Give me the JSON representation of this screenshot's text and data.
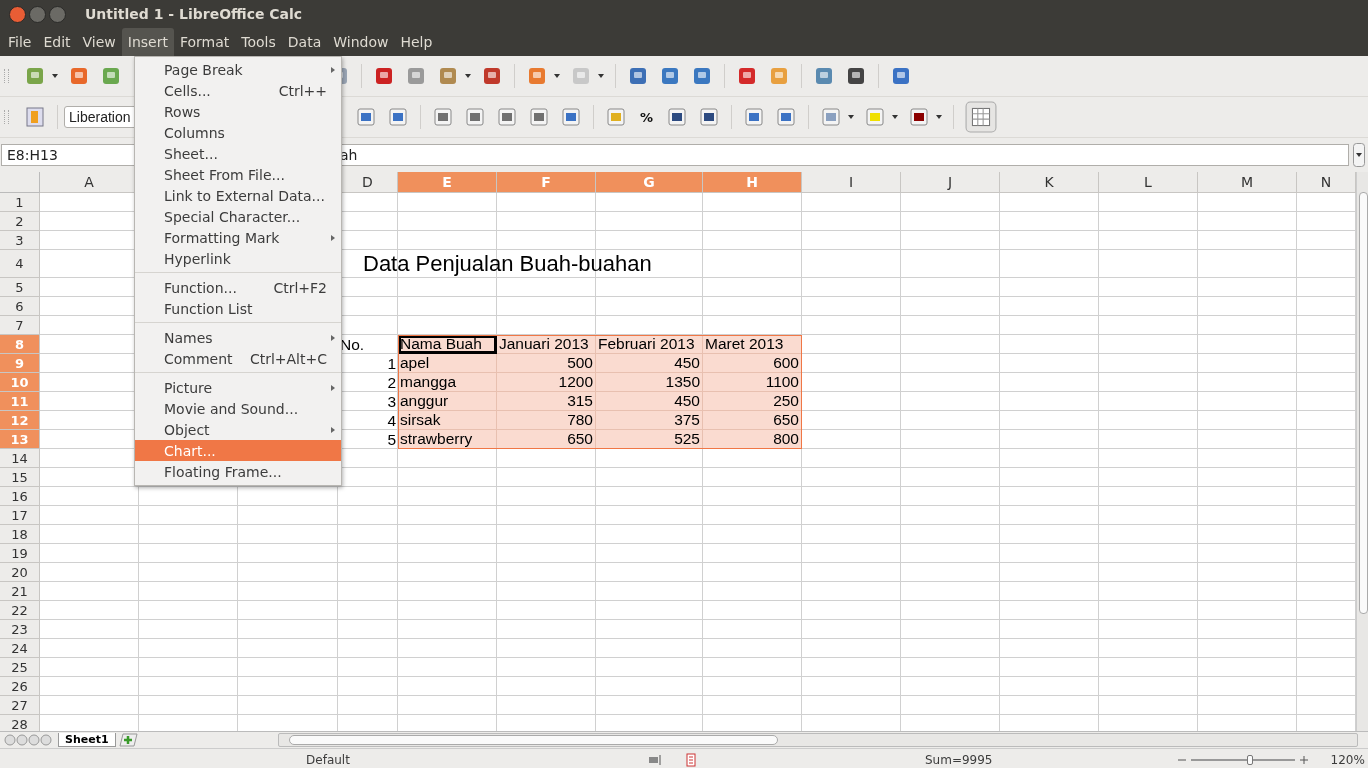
{
  "window": {
    "title": "Untitled 1 - LibreOffice Calc"
  },
  "menu_bar": [
    {
      "label": "File",
      "selected": false
    },
    {
      "label": "Edit",
      "selected": false
    },
    {
      "label": "View",
      "selected": false
    },
    {
      "label": "Insert",
      "selected": true
    },
    {
      "label": "Format",
      "selected": false
    },
    {
      "label": "Tools",
      "selected": false
    },
    {
      "label": "Data",
      "selected": false
    },
    {
      "label": "Window",
      "selected": false
    },
    {
      "label": "Help",
      "selected": false
    }
  ],
  "formatting_toolbar": {
    "font_name": "Liberation",
    "percent_button": "%"
  },
  "formula_bar": {
    "name_box": "E8:H13",
    "content": "ah"
  },
  "insert_menu": [
    [
      {
        "label": "Page Break",
        "submenu": true,
        "selected": false
      },
      {
        "label": "Cells...",
        "shortcut": "Ctrl++",
        "submenu": false,
        "selected": false
      },
      {
        "label": "Rows",
        "submenu": false,
        "selected": false
      },
      {
        "label": "Columns",
        "submenu": false,
        "selected": false
      },
      {
        "label": "Sheet...",
        "submenu": false,
        "selected": false
      },
      {
        "label": "Sheet From File...",
        "submenu": false,
        "selected": false
      },
      {
        "label": "Link to External Data...",
        "submenu": false,
        "selected": false
      },
      {
        "label": "Special Character...",
        "submenu": false,
        "selected": false
      },
      {
        "label": "Formatting Mark",
        "submenu": true,
        "selected": false
      },
      {
        "label": "Hyperlink",
        "submenu": false,
        "selected": false
      }
    ],
    [
      {
        "label": "Function...",
        "shortcut": "Ctrl+F2",
        "submenu": false,
        "selected": false
      },
      {
        "label": "Function List",
        "submenu": false,
        "selected": false
      }
    ],
    [
      {
        "label": "Names",
        "submenu": true,
        "selected": false
      },
      {
        "label": "Comment",
        "shortcut": "Ctrl+Alt+C",
        "submenu": false,
        "selected": false
      }
    ],
    [
      {
        "label": "Picture",
        "submenu": true,
        "selected": false
      },
      {
        "label": "Movie and Sound...",
        "submenu": false,
        "selected": false
      },
      {
        "label": "Object",
        "submenu": true,
        "selected": false
      },
      {
        "label": "Chart...",
        "submenu": false,
        "selected": true
      },
      {
        "label": "Floating Frame...",
        "submenu": false,
        "selected": false
      }
    ]
  ],
  "sheet": {
    "columns": [
      {
        "label": "A",
        "selected": false
      },
      {},
      {},
      {
        "label": "D",
        "selected": false
      },
      {
        "label": "E",
        "selected": true
      },
      {
        "label": "F",
        "selected": true
      },
      {
        "label": "G",
        "selected": true
      },
      {
        "label": "H",
        "selected": true
      },
      {
        "label": "I",
        "selected": false
      },
      {
        "label": "J",
        "selected": false
      },
      {
        "label": "K",
        "selected": false
      },
      {
        "label": "L",
        "selected": false
      },
      {
        "label": "M",
        "selected": false
      },
      {
        "label": "N",
        "selected": false
      }
    ],
    "rows": [
      {
        "label": "1",
        "selected": false
      },
      {
        "label": "2",
        "selected": false
      },
      {
        "label": "3",
        "selected": false
      },
      {
        "label": "4",
        "selected": false
      },
      {
        "label": "5",
        "selected": false
      },
      {
        "label": "6",
        "selected": false
      },
      {
        "label": "7",
        "selected": false
      },
      {
        "label": "8",
        "selected": true
      },
      {
        "label": "9",
        "selected": true
      },
      {
        "label": "10",
        "selected": true
      },
      {
        "label": "11",
        "selected": true
      },
      {
        "label": "12",
        "selected": true
      },
      {
        "label": "13",
        "selected": true
      },
      {
        "label": "14",
        "selected": false
      },
      {
        "label": "15",
        "selected": false
      },
      {
        "label": "16",
        "selected": false
      },
      {
        "label": "17",
        "selected": false
      },
      {
        "label": "18",
        "selected": false
      },
      {
        "label": "19",
        "selected": false
      },
      {
        "label": "20",
        "selected": false
      },
      {
        "label": "21",
        "selected": false
      },
      {
        "label": "22",
        "selected": false
      },
      {
        "label": "23",
        "selected": false
      },
      {
        "label": "24",
        "selected": false
      },
      {
        "label": "25",
        "selected": false
      },
      {
        "label": "26",
        "selected": false
      },
      {
        "label": "27",
        "selected": false
      },
      {
        "label": "28",
        "selected": false
      }
    ],
    "title": "Data Penjualan Buah-buahan",
    "table_header": [
      {
        "text": "No.",
        "active": false
      },
      {
        "text": "Nama Buah",
        "active": true
      },
      {
        "text": "Januari 2013",
        "active": false
      },
      {
        "text": "Februari 2013",
        "active": false
      },
      {
        "text": "Maret 2013",
        "active": false
      }
    ],
    "table_rows": [
      [
        "1",
        " apel",
        "500",
        "450",
        "600"
      ],
      [
        "2",
        "mangga",
        "1200",
        "1350",
        "1100"
      ],
      [
        "3",
        "anggur",
        "315",
        "450",
        "250"
      ],
      [
        "4",
        "sirsak",
        "780",
        "375",
        "650"
      ],
      [
        "5",
        "strawberry",
        "650",
        "525",
        "800"
      ]
    ]
  },
  "sheet_tabs": [
    {
      "label": "Sheet1",
      "selected": true
    }
  ],
  "status_bar": {
    "page_style": "Default",
    "sum": "Sum=9995",
    "zoom": "120%",
    "zoom_level": {
      "level": 0.57
    }
  }
}
